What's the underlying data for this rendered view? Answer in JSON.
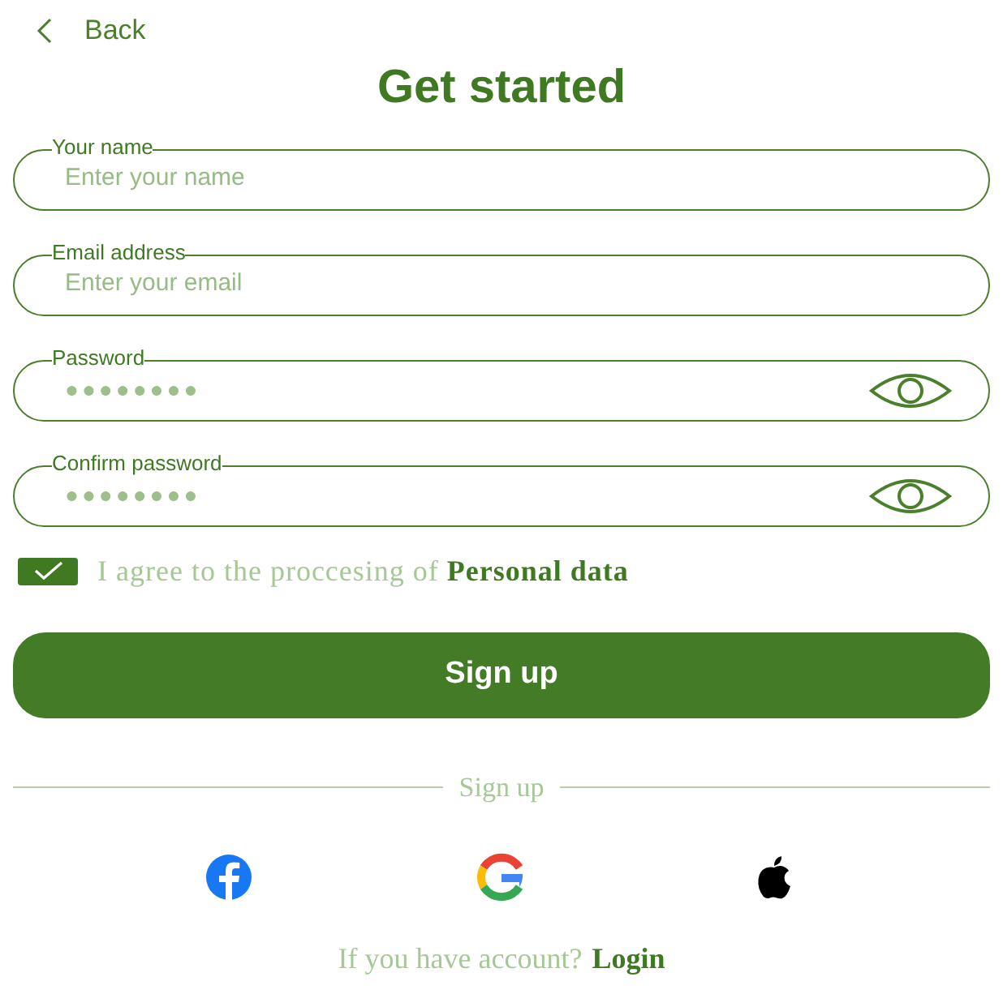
{
  "back": {
    "label": "Back"
  },
  "title": "Get started",
  "fields": [
    {
      "label": "Your name",
      "placeholder": "Enter your name",
      "kind": "text"
    },
    {
      "label": "Email address",
      "placeholder": "Enter your email",
      "kind": "text"
    },
    {
      "label": "Password",
      "value": "●●●●●●●●",
      "kind": "password"
    },
    {
      "label": "Confirm password",
      "value": "●●●●●●●●",
      "kind": "password"
    }
  ],
  "agreement": {
    "checked": true,
    "text": "I agree to the proccesing of **Personal data**"
  },
  "submit": "Sign up",
  "divider": "Sign up",
  "social": [
    {
      "kind": "facebook"
    },
    {
      "kind": "google"
    },
    {
      "kind": "apple"
    }
  ],
  "footer": {
    "text": "If you have account?",
    "link": "Login"
  }
}
